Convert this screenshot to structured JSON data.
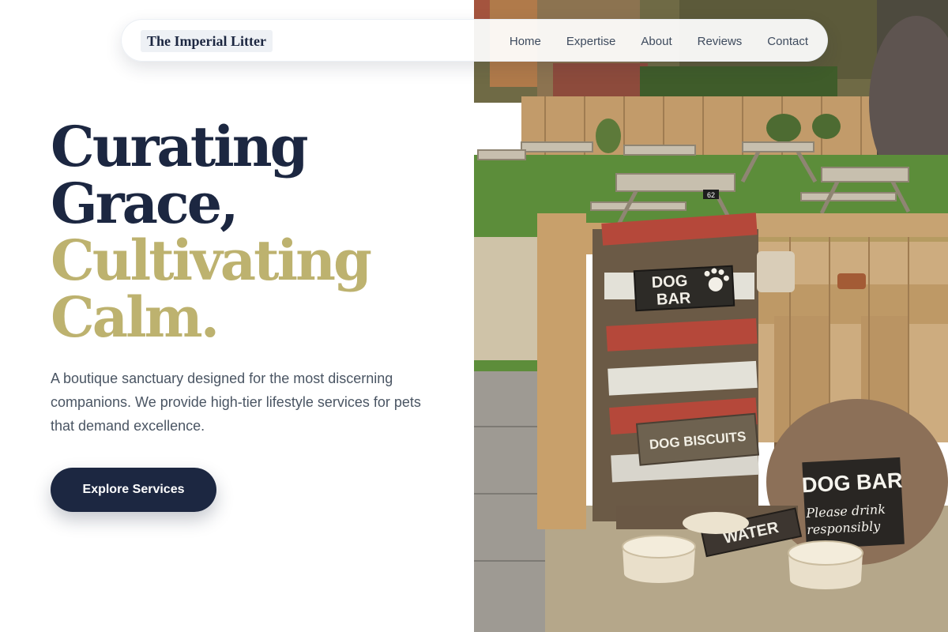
{
  "brand": {
    "name": "The Imperial Litter"
  },
  "nav": {
    "links": [
      "Home",
      "Expertise",
      "About",
      "Reviews",
      "Contact"
    ]
  },
  "hero": {
    "headline": {
      "line1": "Curating",
      "line2": "Grace,",
      "line3": "Cultivating",
      "line4": "Calm."
    },
    "description": "A boutique sanctuary designed for the most discerning companions. We provide high-tier lifestyle services for pets that demand excellence.",
    "cta_label": "Explore Services"
  },
  "photo": {
    "sign_dog_bar_top": [
      "DOG",
      "BAR"
    ],
    "sign_biscuits": "DOG BISCUITS",
    "sign_water": "WATER",
    "sign_dog_bar_bottom": "DOG BAR",
    "sign_tagline": [
      "Please drink",
      "responsibly"
    ],
    "table_number": "62"
  },
  "colors": {
    "navy": "#1c2741",
    "gold": "#bdb26f",
    "body_text": "#4a5563",
    "nav_text": "#3e4b5e"
  }
}
